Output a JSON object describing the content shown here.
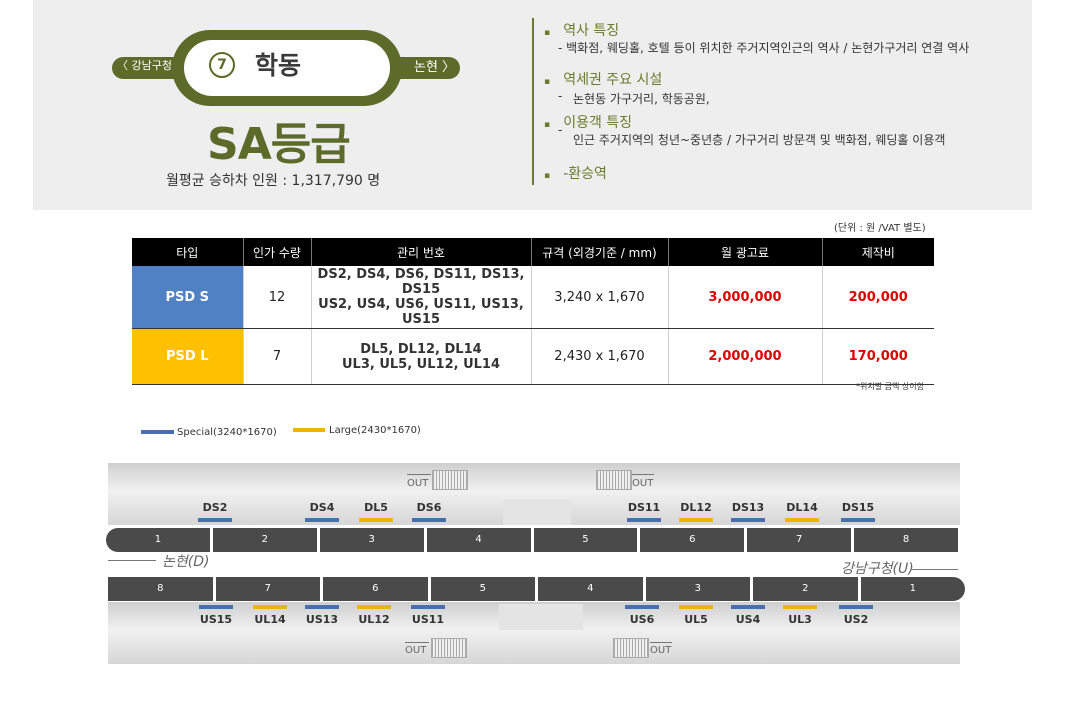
{
  "header": {
    "prev_station": "〈 강남구청",
    "next_station": "논현 〉",
    "station_number": "7",
    "station_name": "학동",
    "grade": "SA등급",
    "ridership": "월평균 승하차 인원 : 1,317,790 명",
    "line_color": "#5d6b2a"
  },
  "features": [
    {
      "bullet": "▪",
      "title": "역사 특징",
      "desc": "-   백화점, 웨딩홀, 호텔 등이 위치한 주거지역인근의 역사 / 논현가구거리 연결 역사"
    },
    {
      "bullet": "▪",
      "title": "역세권 주요 시설",
      "desc": "논현동 가구거리, 학동공원,"
    },
    {
      "bullet": "▪",
      "title": "이용객 특징",
      "desc": "인근 주거지역의 청년~중년층 / 가구거리 방문객 및 백화점, 웨딩홀 이용객"
    },
    {
      "bullet": "▪",
      "title": "-환승역",
      "desc": ""
    }
  ],
  "table": {
    "unit_note": "(단위 : 원 /VAT 별도)",
    "headers": [
      "타입",
      "인가 수량",
      "관리 번호",
      "규격 (외경기준 / mm)",
      "월 광고료",
      "제작비"
    ],
    "rows": [
      {
        "type": "PSD S",
        "qty": "12",
        "ids1": "DS2, DS4, DS6, DS11, DS13, DS15",
        "ids2": "US2, US4, US6, US11, US13, US15",
        "size": "3,240 x 1,670",
        "fee": "3,000,000",
        "cost": "200,000",
        "color": "#4f81c4"
      },
      {
        "type": "PSD L",
        "qty": "7",
        "ids1": "DL5, DL12, DL14",
        "ids2": "UL3, UL5, UL12, UL14",
        "size": "2,430 x 1,670",
        "fee": "2,000,000",
        "cost": "170,000",
        "color": "#ffc000"
      }
    ],
    "footnote": "*위치별 금액 상이함"
  },
  "legend": [
    {
      "label": "Special(3240*1670)",
      "color": "#4a6fb0"
    },
    {
      "label": "Large(2430*1670)",
      "color": "#f0b400"
    }
  ],
  "map": {
    "out_label": "OUT",
    "left_direction": "논현(D)",
    "right_direction": "강남구청(U)",
    "top_cars": [
      "1",
      "2",
      "3",
      "4",
      "5",
      "6",
      "7",
      "8"
    ],
    "bottom_cars": [
      "8",
      "7",
      "6",
      "5",
      "4",
      "3",
      "2",
      "1"
    ],
    "top_labels": [
      "DS2",
      "DS4",
      "DL5",
      "DS6",
      "DS11",
      "DL12",
      "DS13",
      "DL14",
      "DS15"
    ],
    "bottom_labels": [
      "US15",
      "UL14",
      "US13",
      "UL12",
      "US11",
      "US6",
      "UL5",
      "US4",
      "UL3",
      "US2"
    ]
  }
}
